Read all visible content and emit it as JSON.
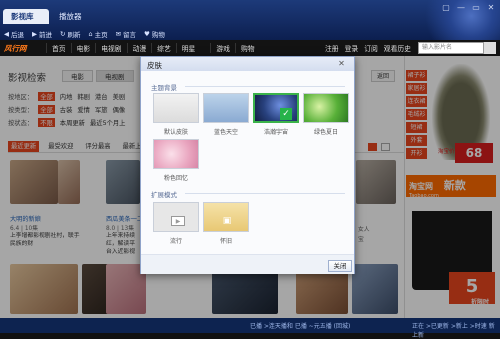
{
  "chrome": {
    "tabs": [
      "影视库",
      "播放器"
    ],
    "nav": [
      "后退",
      "前进",
      "刷新",
      "主页",
      "留言",
      "购物"
    ],
    "window_buttons": [
      "▢",
      "—",
      "▭",
      "✕"
    ]
  },
  "site": {
    "logo": "风行网",
    "menu": [
      "首页",
      "电影",
      "电视剧",
      "动漫",
      "综艺",
      "明星",
      "游戏",
      "购物"
    ],
    "top_links": [
      "注册",
      "登录",
      "订阅",
      "观看历史"
    ],
    "search_placeholder": "输入影片名"
  },
  "page": {
    "title": "影视检索",
    "tabs": [
      "电影",
      "电视剧"
    ],
    "filters": [
      {
        "label": "按地区：",
        "selected": "全部",
        "options": [
          "内地",
          "韩剧",
          "港台",
          "美剧"
        ]
      },
      {
        "label": "按类型：",
        "selected": "全部",
        "options": [
          "古装",
          "爱情",
          "军旅",
          "偶像"
        ]
      },
      {
        "label": "按状态：",
        "selected": "不限",
        "options": [
          "本周更新",
          "最近5个月上"
        ]
      }
    ],
    "sort": [
      "最近更新",
      "最受欢迎",
      "评分最高",
      "最新上"
    ],
    "sort_right_label": "返回",
    "cards": [
      {
        "title": "大明的新娘",
        "meta": "6.4 | 10集",
        "desc": "上李增都影视剧社村，联手民族的财"
      },
      {
        "title": "西瓜美条一二",
        "meta": "8.0 | 13集",
        "desc": "上年来持续红，解读平台入近影视连续"
      }
    ],
    "row2_right_labels": [
      "女人",
      "宝"
    ]
  },
  "ads": {
    "tags": [
      "裙子衫",
      "家居衫",
      "连衣裙",
      "毛绒衫",
      "短裙",
      "外套",
      "开衫"
    ],
    "price": "68",
    "price_prefix": "淘宝价",
    "shop": "淘宝网",
    "shop_sub": "Taobao.com",
    "headline": "新款",
    "badge": "5",
    "badge_caption": "折限时"
  },
  "status": {
    "center": "已播 >连天播和 已播 ~元五播 (回城)",
    "right": "正在 >已更新 >新上 >时速 新上新"
  },
  "dialog": {
    "title": "皮肤",
    "close": "✕",
    "section_bg": "主题背景",
    "skins": [
      "默认皮肤",
      "蓝色天空",
      "浩瀚宇宙",
      "绿色夏日",
      "粉色回忆"
    ],
    "selected_skin": "浩瀚宇宙",
    "section_mode": "扩展模式",
    "modes": [
      "流行",
      "怀旧"
    ],
    "close_button": "关闭"
  }
}
